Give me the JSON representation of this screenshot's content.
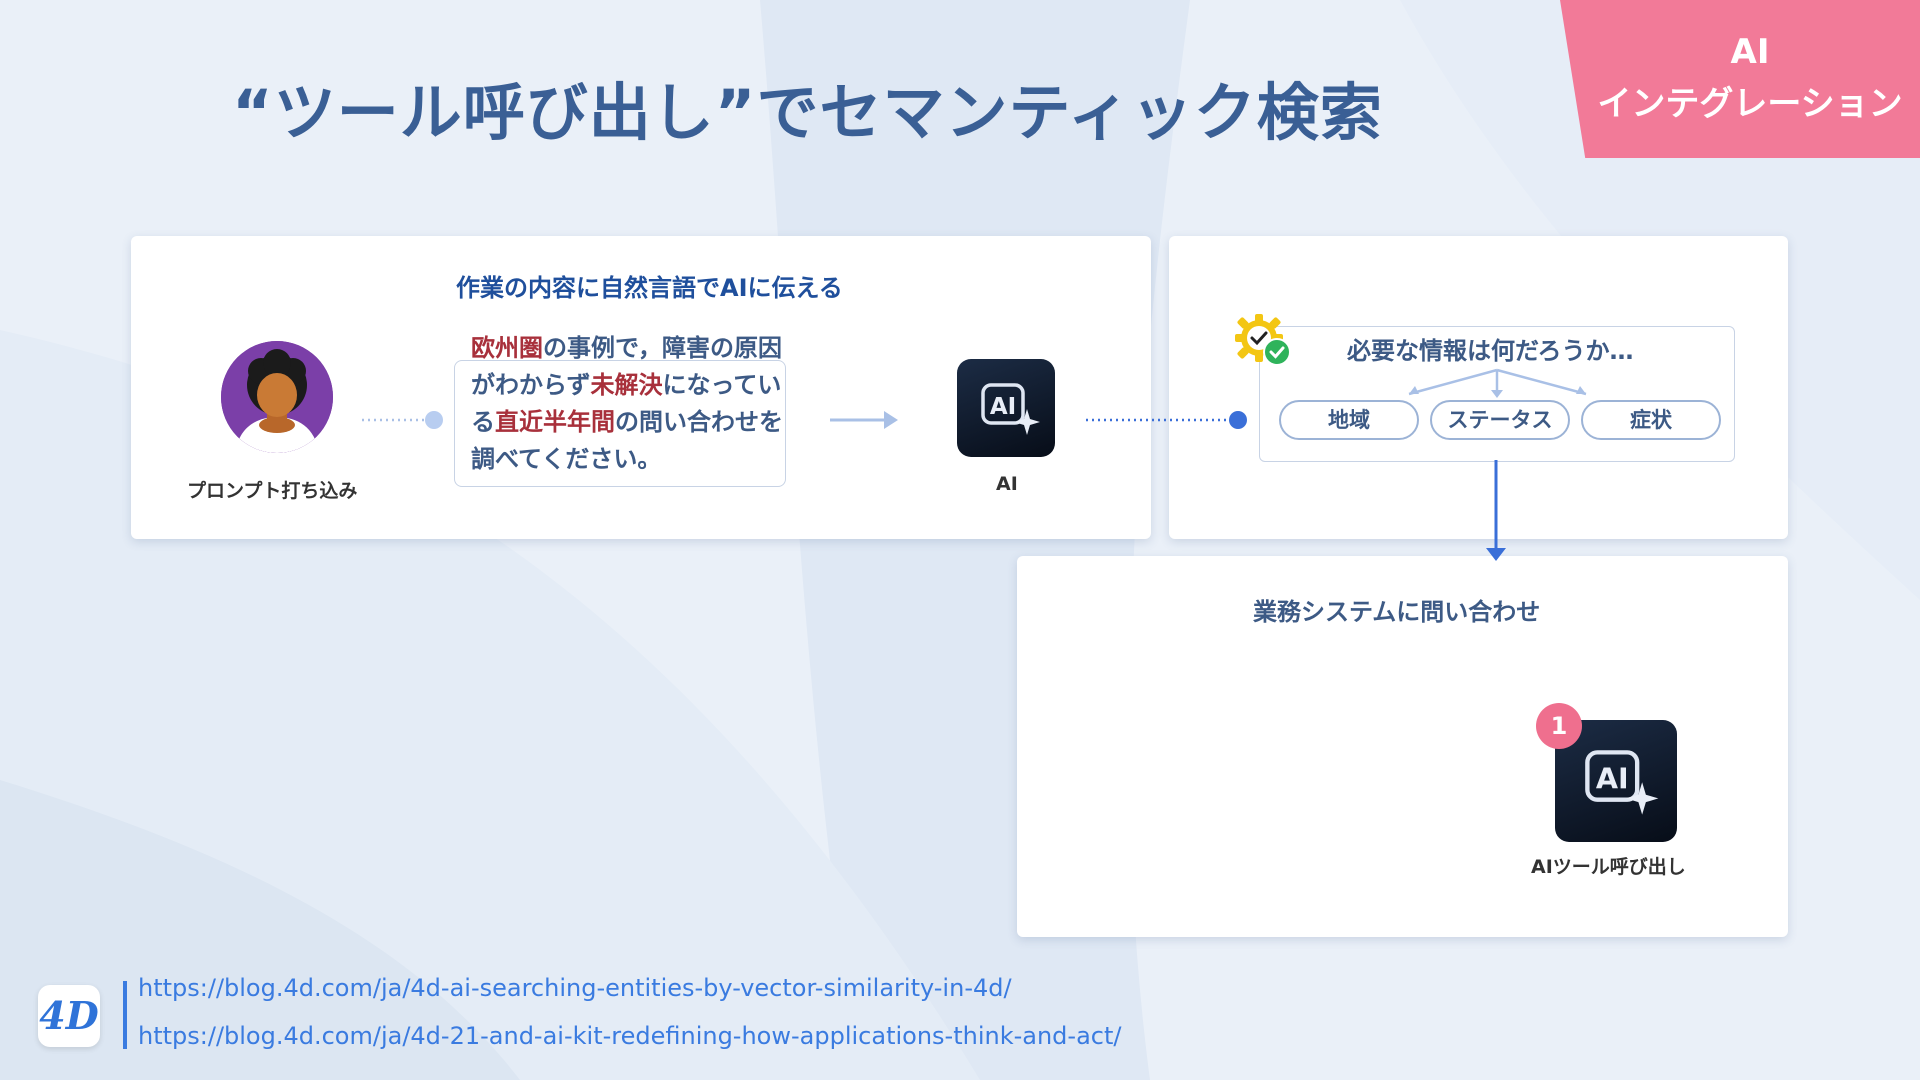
{
  "title": "“ツール呼び出し”でセマンティック検索",
  "tag": {
    "line1": "AI",
    "line2": "インテグレーション"
  },
  "card1": {
    "heading": "作業の内容に自然言語でAIに伝える",
    "user_caption": "プロンプト打ち込み",
    "prompt": {
      "p1": "欧州圏",
      "p2": "の事例で，障害の原因がわからず",
      "p3": "未解決",
      "p4": "になっている",
      "p5": "直近半年間",
      "p6": "の問い合わせを調べてください。"
    },
    "ai_caption": "AI",
    "ai_icon_text": "AI"
  },
  "card2": {
    "heading": "必要な情報は何だろうか…",
    "pills": [
      "地域",
      "ステータス",
      "症状"
    ]
  },
  "card3": {
    "heading": "業務システムに問い合わせ",
    "badge": "1",
    "tool_caption": "AIツール呼び出し",
    "ai_icon_text": "AI"
  },
  "footer": {
    "logo": "4D",
    "links": [
      "https://blog.4d.com/ja/4d-ai-searching-entities-by-vector-similarity-in-4d/",
      "https://blog.4d.com/ja/4d-21-and-ai-kit-redefining-how-applications-think-and-act/"
    ]
  },
  "colors": {
    "title": "#3a5f95",
    "accent_pink": "#f27a98",
    "highlight_red": "#a8303b",
    "link_blue": "#3a7be0"
  }
}
